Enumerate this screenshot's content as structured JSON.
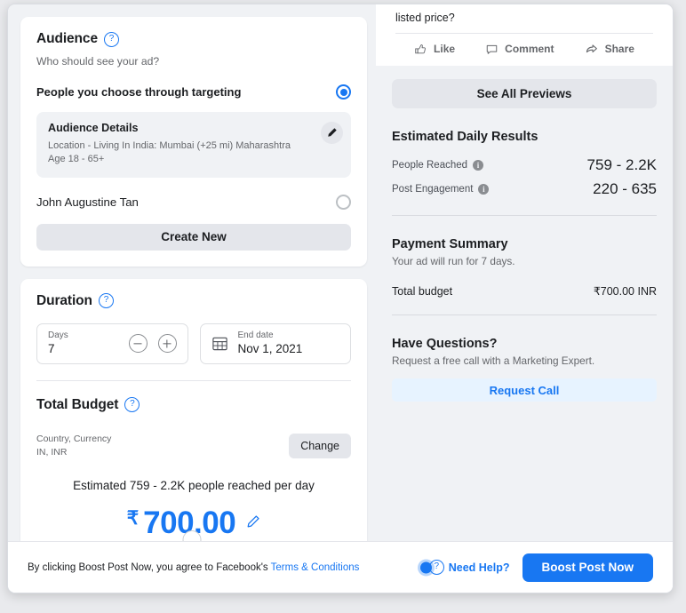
{
  "audience": {
    "title": "Audience",
    "help_icon": "question-circle-icon",
    "subtitle": "Who should see your ad?",
    "option_targeting": "People you choose through targeting",
    "details": {
      "title": "Audience Details",
      "line1": "Location - Living In India: Mumbai (+25 mi) Maharashtra",
      "line2": "Age 18 - 65+",
      "edit_icon": "pencil-icon"
    },
    "option_saved": "John Augustine Tan",
    "create_new": "Create New"
  },
  "duration": {
    "title": "Duration",
    "days_label": "Days",
    "days_value": "7",
    "decrement_icon": "minus-circle-icon",
    "increment_icon": "plus-circle-icon",
    "calendar_icon": "calendar-icon",
    "enddate_label": "End date",
    "enddate_value": "Nov 1, 2021"
  },
  "total_budget": {
    "title": "Total Budget",
    "country_currency_label": "Country, Currency",
    "country_currency_value": "IN, INR",
    "change_label": "Change",
    "estimate_line": "Estimated 759 - 2.2K people reached per day",
    "currency_symbol": "₹",
    "amount": "700.00",
    "edit_icon": "pencil-icon"
  },
  "preview": {
    "text": "listed price?",
    "actions": [
      {
        "label": "Like",
        "icon": "thumbs-up-icon"
      },
      {
        "label": "Comment",
        "icon": "comment-bubble-icon"
      },
      {
        "label": "Share",
        "icon": "share-arrow-icon"
      }
    ],
    "see_all_previews": "See All Previews"
  },
  "estimated_results": {
    "title": "Estimated Daily Results",
    "rows": [
      {
        "label": "People Reached",
        "value": "759 - 2.2K",
        "icon": "info-icon"
      },
      {
        "label": "Post Engagement",
        "value": "220 - 635",
        "icon": "info-icon"
      }
    ]
  },
  "payment_summary": {
    "title": "Payment Summary",
    "subtitle": "Your ad will run for 7 days.",
    "total_budget_label": "Total budget",
    "total_budget_value": "₹700.00 INR"
  },
  "have_questions": {
    "title": "Have Questions?",
    "subtitle": "Request a free call with a Marketing Expert.",
    "request_call": "Request Call"
  },
  "footer": {
    "legal_prefix": "By clicking Boost Post Now, you agree to Facebook's ",
    "legal_link": "Terms & Conditions",
    "need_help": "Need Help?",
    "need_help_icon": "question-circle-icon",
    "boost_button": "Boost Post Now"
  },
  "colors": {
    "accent": "#1877f2",
    "panel_bg": "#f0f2f5",
    "muted_text": "#65676b",
    "button_bg": "#e4e6eb",
    "link_bg": "#e7f3ff"
  }
}
